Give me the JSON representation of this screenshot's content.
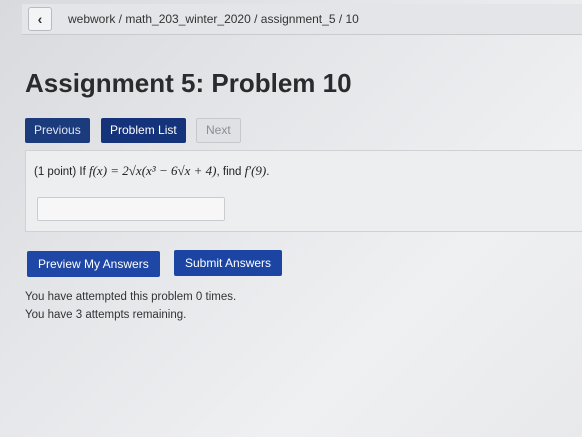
{
  "nav": {
    "back_icon": "‹",
    "breadcrumb": "webwork / math_203_winter_2020 / assignment_5 / 10"
  },
  "page": {
    "title": "Assignment 5: Problem 10"
  },
  "buttons": {
    "previous": "Previous",
    "problem_list": "Problem List",
    "next": "Next",
    "preview": "Preview My Answers",
    "submit": "Submit Answers"
  },
  "problem": {
    "points": "(1 point)",
    "prefix": "If",
    "function": "f(x) = 2√x(x³ − 6√x + 4)",
    "mid": ", find",
    "target": "f′(9)",
    "end": ".",
    "answer_value": ""
  },
  "status": {
    "attempted": "You have attempted this problem 0 times.",
    "remaining": "You have 3 attempts remaining."
  },
  "colors": {
    "primary_button": "#1b44a3",
    "nav_button": "#14337a",
    "disabled_button": "#dfe1e4"
  }
}
